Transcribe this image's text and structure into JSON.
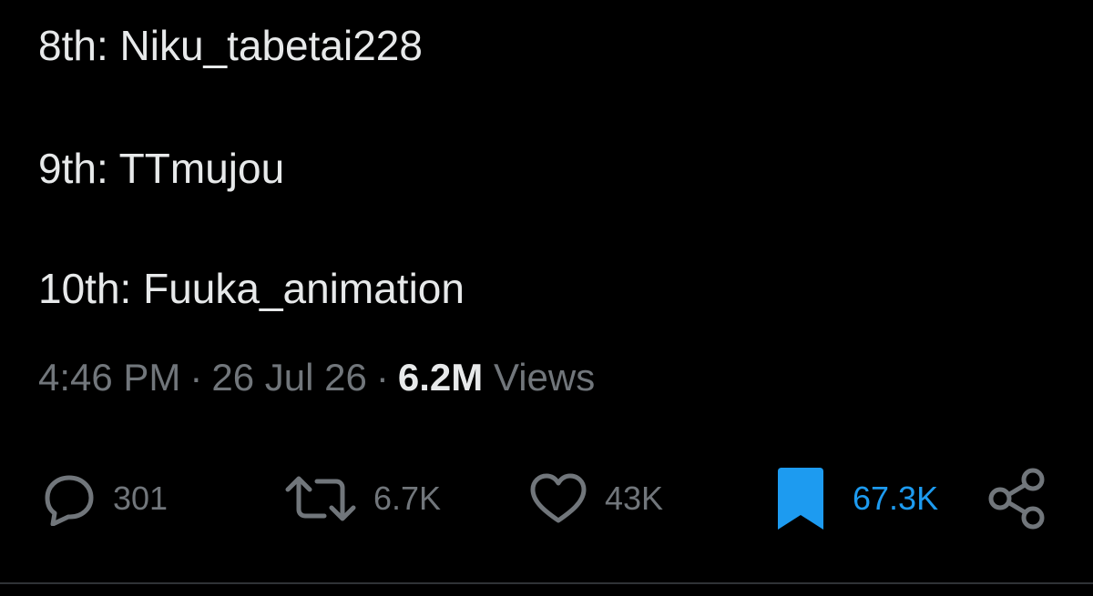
{
  "tweet": {
    "lines": [
      "8th: Niku_tabetai228",
      "9th: TTmujou",
      "10th: Fuuka_animation"
    ],
    "time": "4:46 PM",
    "date": "26 Jul 26",
    "separator": "·",
    "views_count": "6.2M",
    "views_label": "Views"
  },
  "actions": {
    "reply": {
      "icon": "reply-icon",
      "count": "301"
    },
    "repost": {
      "icon": "repost-icon",
      "count": "6.7K"
    },
    "like": {
      "icon": "heart-icon",
      "count": "43K"
    },
    "bookmark": {
      "icon": "bookmark-icon",
      "count": "67.3K",
      "active": true
    },
    "share": {
      "icon": "share-icon"
    }
  },
  "colors": {
    "background": "#000000",
    "text_primary": "#e7e9ea",
    "text_secondary": "#71767b",
    "accent": "#1d9bf0"
  }
}
